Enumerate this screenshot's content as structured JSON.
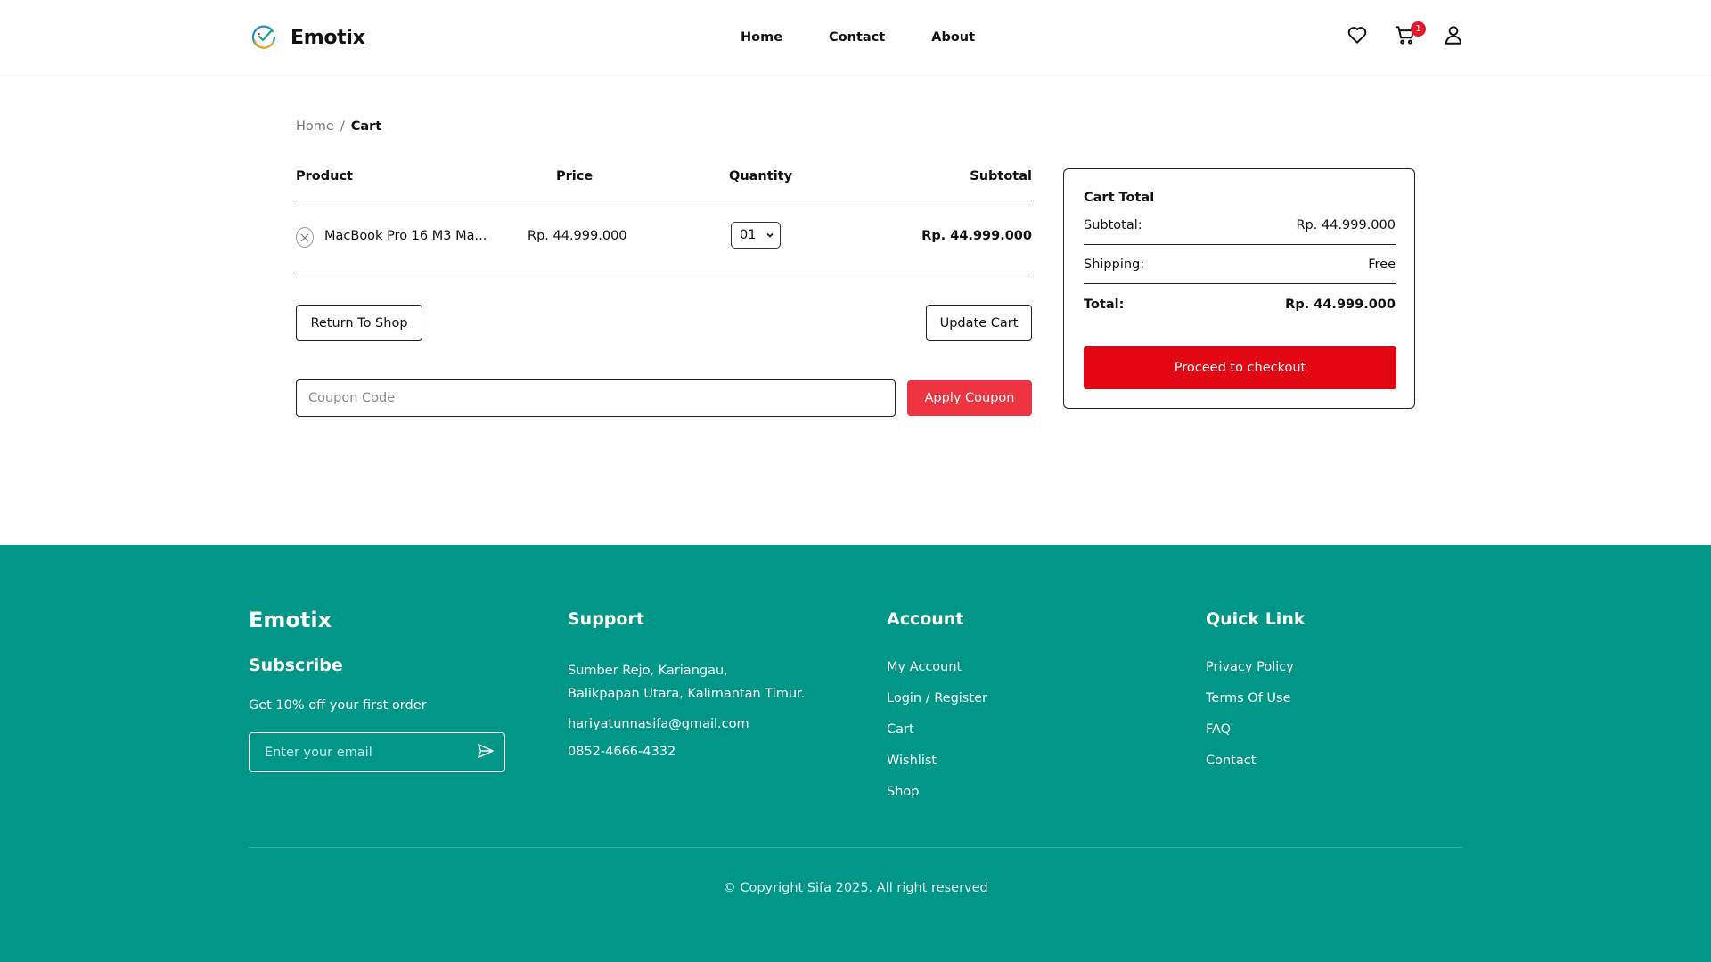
{
  "header": {
    "brand": "Emotix",
    "nav": [
      "Home",
      "Contact",
      "About"
    ],
    "cart_count": "1"
  },
  "breadcrumb": {
    "home": "Home",
    "separator": "/",
    "current": "Cart"
  },
  "cart": {
    "columns": [
      "Product",
      "Price",
      "Quantity",
      "Subtotal"
    ],
    "items": [
      {
        "name": "MacBook Pro 16 M3 Ma...",
        "price": "Rp. 44.999.000",
        "quantity": "01",
        "subtotal": "Rp. 44.999.000"
      }
    ],
    "return_label": "Return To Shop",
    "update_label": "Update Cart",
    "coupon_placeholder": "Coupon Code",
    "apply_label": "Apply Coupon"
  },
  "totals": {
    "title": "Cart Total",
    "subtotal_label": "Subtotal:",
    "subtotal_value": "Rp. 44.999.000",
    "shipping_label": "Shipping:",
    "shipping_value": "Free",
    "total_label": "Total:",
    "total_value": "Rp. 44.999.000",
    "checkout_label": "Proceed to checkout"
  },
  "footer": {
    "brand": "Emotix",
    "subscribe_title": "Subscribe",
    "subscribe_text": "Get 10% off your first order",
    "email_placeholder": "Enter your email",
    "support_title": "Support",
    "support": {
      "address_line1": "Sumber Rejo, Kariangau,",
      "address_line2": "Balikpapan Utara, Kalimantan Timur.",
      "email": "hariyatunnasifa@gmail.com",
      "phone": "0852-4666-4332"
    },
    "account_title": "Account",
    "account_links": [
      "My Account",
      "Login / Register",
      "Cart",
      "Wishlist",
      "Shop"
    ],
    "quicklink_title": "Quick Link",
    "quick_links": [
      "Privacy Policy",
      "Terms Of Use",
      "FAQ",
      "Contact"
    ],
    "copyright": "© Copyright Sifa 2025. All right reserved"
  },
  "colors": {
    "accent_red": "#e30613",
    "footer_teal": "#009688"
  },
  "icons": {
    "wishlist": "heart-icon",
    "cart": "cart-icon",
    "account": "user-icon",
    "send": "send-icon",
    "remove": "close-icon",
    "dropdown": "chevron-down-icon"
  }
}
